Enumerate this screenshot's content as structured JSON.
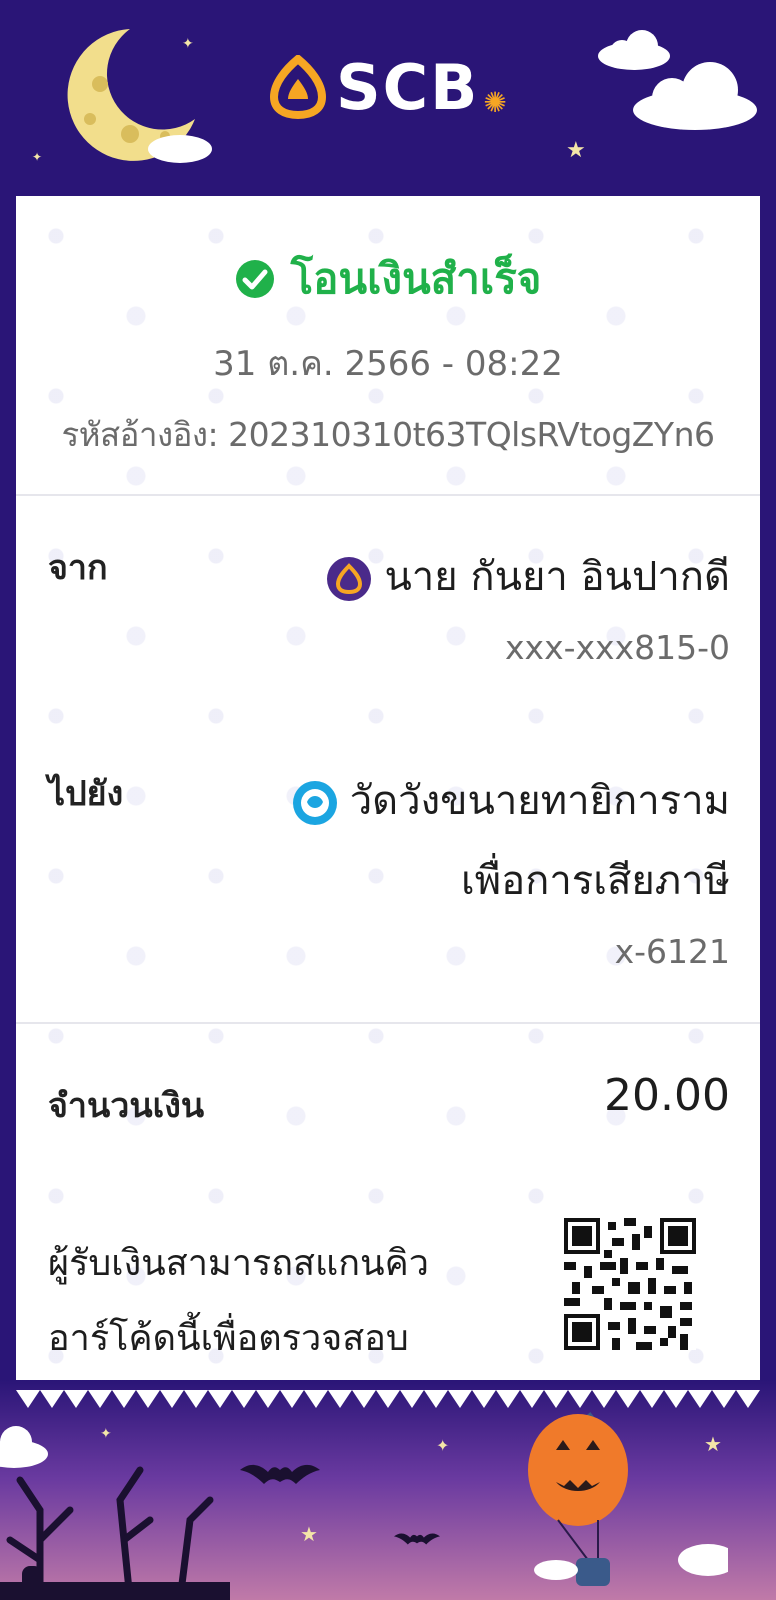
{
  "brand": {
    "name": "SCB",
    "primary_color": "#2a1577",
    "accent_color": "#f6a623",
    "success_color": "#20b14a"
  },
  "slip": {
    "status": "โอนเงินสำเร็จ",
    "datetime": "31 ต.ค. 2566 - 08:22",
    "reference_label": "รหัสอ้างอิง:",
    "reference_value": "202310310t63TQlsRVtogZYn6",
    "from": {
      "label": "จาก",
      "name": "นาย กันยา อินปากดี",
      "account": "xxx-xxx815-0",
      "bank_icon": "scb-bank-icon"
    },
    "to": {
      "label": "ไปยัง",
      "name_line1": "วัดวังขนายทายิการาม",
      "name_line2": "เพื่อการเสียภาษี",
      "account": "x-6121",
      "bank_icon": "krungthai-bank-icon"
    },
    "amount": {
      "label": "จำนวนเงิน",
      "value": "20.00"
    },
    "qr_note_line1": "ผู้รับเงินสามารถสแกนคิว",
    "qr_note_line2": "อาร์โค้ดนี้เพื่อตรวจสอบ"
  }
}
